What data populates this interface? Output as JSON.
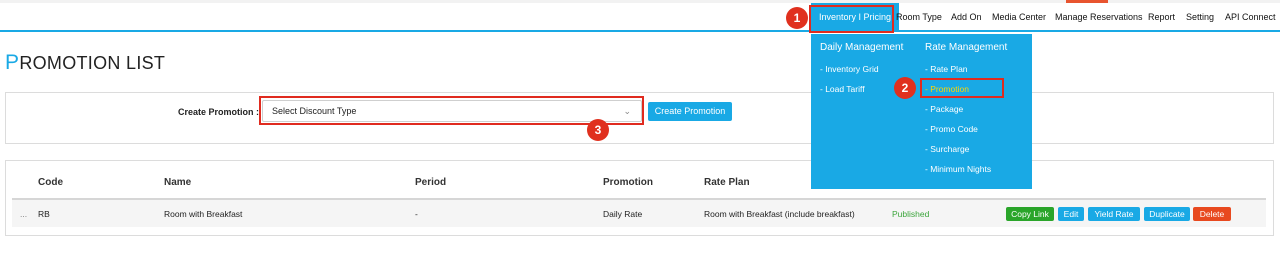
{
  "nav": {
    "items": [
      {
        "label": "Inventory I Pricing"
      },
      {
        "label": "Room Type"
      },
      {
        "label": "Add On"
      },
      {
        "label": "Media Center"
      },
      {
        "label": "Manage Reservations"
      },
      {
        "label": "Report"
      },
      {
        "label": "Setting"
      },
      {
        "label": "API Connect"
      }
    ]
  },
  "page": {
    "title_first": "P",
    "title_rest": "ROMOTION LIST"
  },
  "create": {
    "label": "Create Promotion :",
    "select_value": "Select Discount Type",
    "button": "Create Promotion"
  },
  "table": {
    "headers": [
      "Code",
      "Name",
      "Period",
      "Promotion",
      "Rate Plan"
    ],
    "rows": [
      {
        "handle": "...",
        "code": "RB",
        "name": "Room with Breakfast",
        "period": "-",
        "promotion": "Daily Rate",
        "rate_plan": "Room with Breakfast (include breakfast)",
        "status": "Published",
        "actions": [
          "Copy Link",
          "Edit",
          "Yield Rate",
          "Duplicate",
          "Delete"
        ]
      }
    ]
  },
  "dropdown": {
    "daily_heading": "Daily Management",
    "daily_items": [
      "- Inventory Grid",
      "- Load Tariff"
    ],
    "rate_heading": "Rate Management",
    "rate_items": [
      "- Rate Plan",
      "- Promotion",
      "- Package",
      "- Promo Code",
      "- Surcharge",
      "- Minimum Nights"
    ]
  },
  "annotations": {
    "badges": [
      "1",
      "2",
      "3"
    ]
  },
  "colors": {
    "accent": "#19a9e5",
    "highlight_red": "#e02b1f",
    "published_green": "#3ca53c",
    "active_item_yellow": "#ffd600",
    "copy_link_green": "#2aa52a",
    "delete_orange": "#e8491f"
  }
}
